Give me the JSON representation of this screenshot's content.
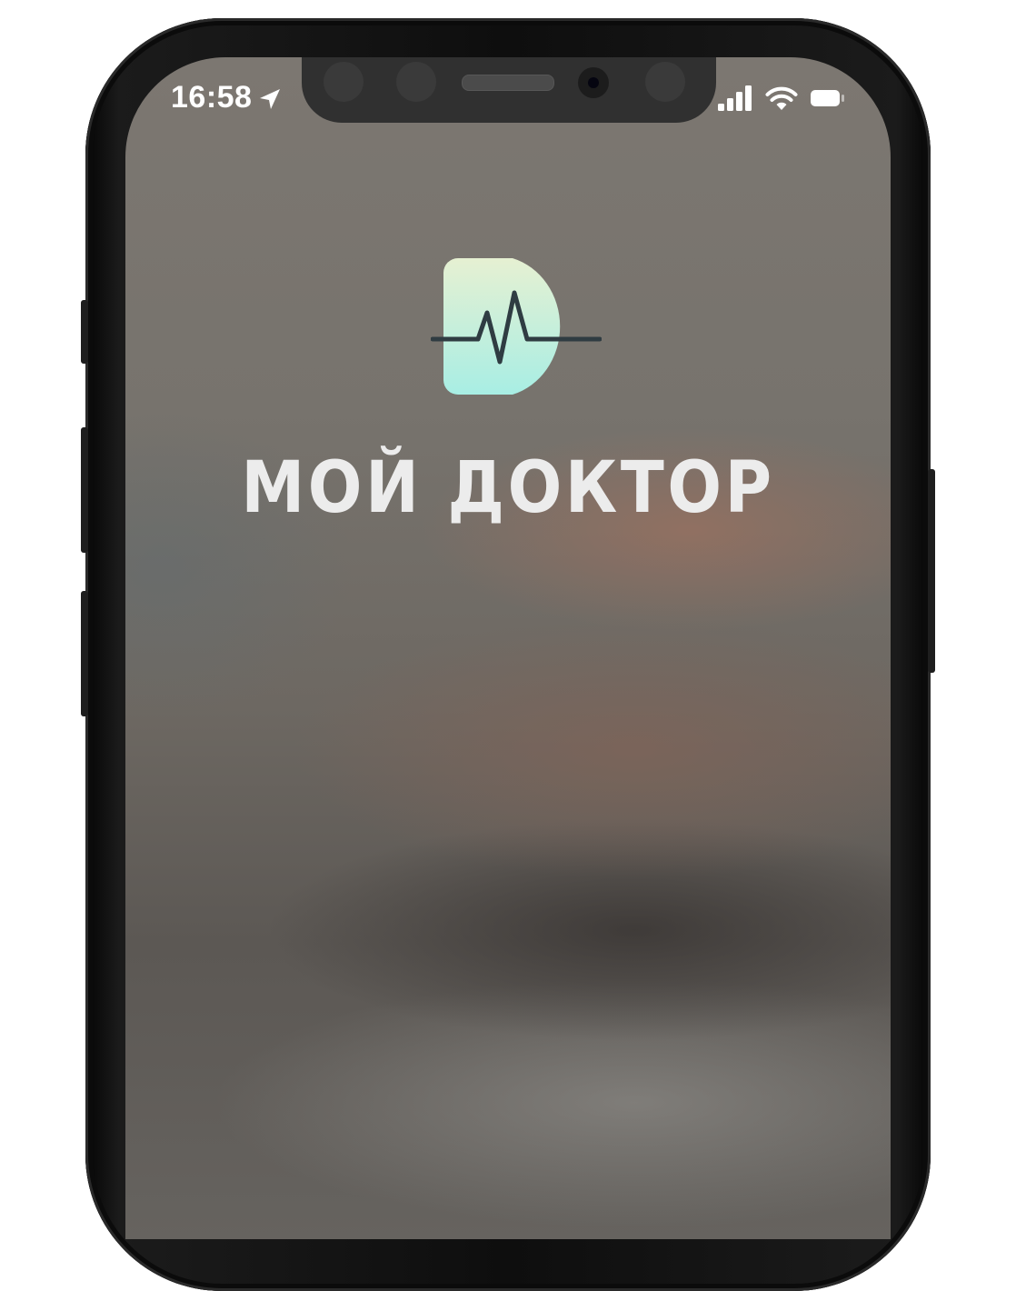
{
  "status_bar": {
    "time": "16:58",
    "icons": [
      "location-arrow-icon",
      "cellular-signal-icon",
      "wifi-icon",
      "battery-icon"
    ]
  },
  "splash": {
    "logo_icon": "heartbeat-d-logo-icon",
    "title": "МОЙ ДОКТОР"
  },
  "colors": {
    "logo_gradient_top": "#e6f0d2",
    "logo_gradient_bottom": "#a8eee4",
    "pulse_line": "#2f3c42",
    "title_text": "#ececec",
    "status_text": "#ffffff"
  }
}
